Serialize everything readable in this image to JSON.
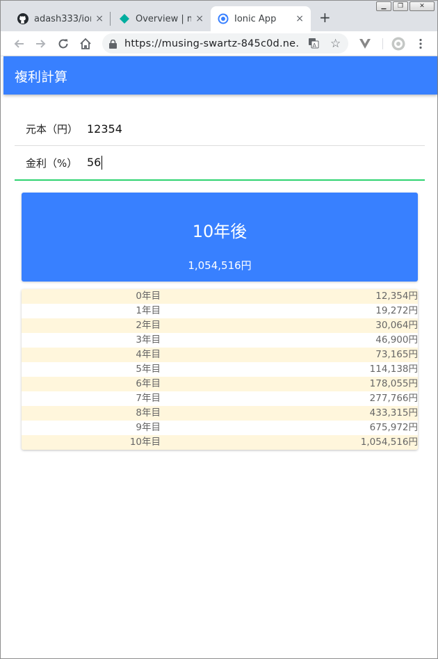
{
  "browser": {
    "tabs": [
      {
        "label": "adash333/ion",
        "icon": "github-icon"
      },
      {
        "label": "Overview | m",
        "icon": "diamond-icon"
      },
      {
        "label": "Ionic App",
        "icon": "ionic-icon"
      }
    ],
    "new_tab": "+",
    "close": "×",
    "url": "https://musing-swartz-845c0d.ne…"
  },
  "app": {
    "title": "複利計算",
    "fields": {
      "principal_label": "元本（円）",
      "principal_value": "12354",
      "rate_label": "金利（%）",
      "rate_value": "56"
    },
    "result": {
      "title": "10年後",
      "value": "1,054,516円"
    },
    "table": [
      {
        "year": "0年目",
        "amount": "12,354円"
      },
      {
        "year": "1年目",
        "amount": "19,272円"
      },
      {
        "year": "2年目",
        "amount": "30,064円"
      },
      {
        "year": "3年目",
        "amount": "46,900円"
      },
      {
        "year": "4年目",
        "amount": "73,165円"
      },
      {
        "year": "5年目",
        "amount": "114,138円"
      },
      {
        "year": "6年目",
        "amount": "178,055円"
      },
      {
        "year": "7年目",
        "amount": "277,766円"
      },
      {
        "year": "8年目",
        "amount": "433,315円"
      },
      {
        "year": "9年目",
        "amount": "675,972円"
      },
      {
        "year": "10年目",
        "amount": "1,054,516円"
      }
    ]
  },
  "colors": {
    "primary": "#3880ff",
    "focus_underline": "#2dd36f",
    "row_highlight": "#fff6dc"
  }
}
